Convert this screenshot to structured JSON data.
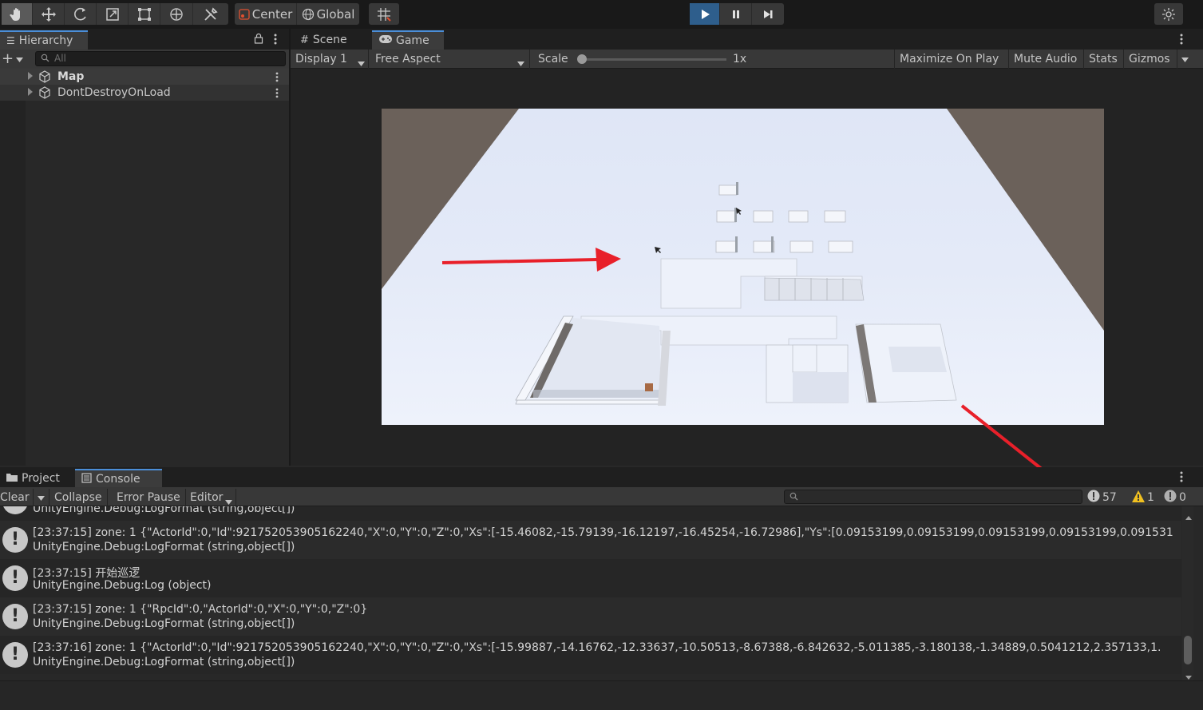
{
  "toolbar": {
    "tools": [
      "hand-tool",
      "move-tool",
      "rotate-tool",
      "scale-tool",
      "rect-tool",
      "transform-tool",
      "custom-tool"
    ],
    "pivot_label": "Center",
    "space_label": "Global",
    "grid_icon": "grid-snap-icon"
  },
  "hierarchy": {
    "tab_label": "Hierarchy",
    "search_placeholder": "All",
    "items": [
      {
        "label": "Map",
        "bold": true
      },
      {
        "label": "DontDestroyOnLoad",
        "bold": false
      }
    ]
  },
  "game": {
    "tabs": [
      {
        "label": "Scene",
        "icon": "hash-icon"
      },
      {
        "label": "Game",
        "icon": "gamepad-icon"
      }
    ],
    "display_label": "Display 1",
    "aspect_label": "Free Aspect",
    "scale_label": "Scale",
    "scale_value": "1x",
    "maximize_label": "Maximize On Play",
    "mute_label": "Mute Audio",
    "stats_label": "Stats",
    "gizmos_label": "Gizmos"
  },
  "console": {
    "tabs": [
      {
        "label": "Project",
        "icon": "folder-icon"
      },
      {
        "label": "Console",
        "icon": "console-icon"
      }
    ],
    "clear_label": "Clear",
    "collapse_label": "Collapse",
    "error_pause_label": "Error Pause",
    "editor_label": "Editor",
    "counts": {
      "info": "57",
      "warning": "1",
      "error": "0"
    },
    "partial_row": "UnityEngine.Debug:LogFormat (string,object[])",
    "entries": [
      {
        "line1": "[23:37:15] zone: 1 {\"ActorId\":0,\"Id\":921752053905162240,\"X\":0,\"Y\":0,\"Z\":0,\"Xs\":[-15.46082,-15.79139,-16.12197,-16.45254,-16.72986],\"Ys\":[0.09153199,0.09153199,0.09153199,0.09153199,0.091531",
        "line2": "UnityEngine.Debug:LogFormat (string,object[])"
      },
      {
        "line1": "[23:37:15] 开始巡逻",
        "line2": "UnityEngine.Debug:Log (object)"
      },
      {
        "line1": "[23:37:15] zone: 1 {\"RpcId\":0,\"ActorId\":0,\"X\":0,\"Y\":0,\"Z\":0}",
        "line2": "UnityEngine.Debug:LogFormat (string,object[])"
      },
      {
        "line1": "[23:37:16] zone: 1 {\"ActorId\":0,\"Id\":921752053905162240,\"X\":0,\"Y\":0,\"Z\":0,\"Xs\":[-15.99887,-14.16762,-12.33637,-10.50513,-8.67388,-6.842632,-5.011385,-3.180138,-1.34889,0.5041212,2.357133,1.",
        "line2": "UnityEngine.Debug:LogFormat (string,object[])"
      }
    ]
  },
  "colors": {
    "accent": "#4b8ed8",
    "annotation_arrow": "#e8202a",
    "play_active": "#2e5e8c"
  }
}
